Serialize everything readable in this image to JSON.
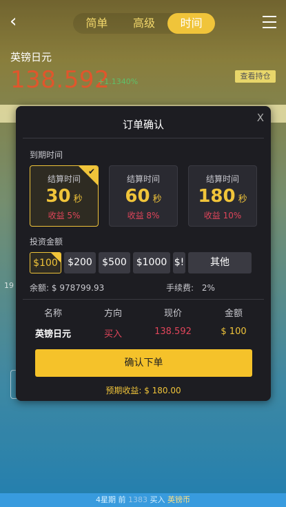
{
  "header": {
    "back_icon": "chevron-left-icon",
    "tabs": [
      {
        "label": "简单",
        "active": false
      },
      {
        "label": "高级",
        "active": false
      },
      {
        "label": "时间",
        "active": true
      }
    ],
    "menu_icon": "hamburger-menu-icon"
  },
  "asset": {
    "name": "英镑日元",
    "price": "138.592",
    "change": "+1.1340%",
    "hold_button": "查看持仓"
  },
  "background": {
    "side_left": "19",
    "ticker": {
      "prefix": "4星期 前",
      "number": "1383",
      "action": "买入",
      "symbol": "英镑币"
    }
  },
  "modal": {
    "title": "订单确认",
    "close_label": "X",
    "expiry_section": "到期时间",
    "time_options": [
      {
        "label": "结算时间",
        "value": "30",
        "unit": "秒",
        "profit": "收益 5%",
        "selected": true
      },
      {
        "label": "结算时间",
        "value": "60",
        "unit": "秒",
        "profit": "收益 8%",
        "selected": false
      },
      {
        "label": "结算时间",
        "value": "180",
        "unit": "秒",
        "profit": "收益 10%",
        "selected": false
      }
    ],
    "amount_section": "投资金额",
    "amounts": [
      {
        "label": "$100",
        "selected": true
      },
      {
        "label": "$200",
        "selected": false
      },
      {
        "label": "$500",
        "selected": false
      },
      {
        "label": "$1000",
        "selected": false
      },
      {
        "label": "$!",
        "selected": false
      },
      {
        "label": "其他",
        "selected": false
      }
    ],
    "balance_label": "余额:",
    "balance_value": "$ 978799.93",
    "fee_label": "手续费:",
    "fee_value": "2%",
    "table_headers": [
      "名称",
      "方向",
      "现价",
      "金额"
    ],
    "table_row": {
      "name": "英镑日元",
      "direction": "买入",
      "price": "138.592",
      "amount": "$ 100"
    },
    "confirm_button": "确认下单",
    "expected_profit": "预期收益: $ 180.00"
  },
  "colors": {
    "accent": "#f0c43a",
    "profit_red": "#e0455a",
    "price_red": "#e0562c",
    "change_green": "#5ec06a",
    "modal_bg": "#1d1d22"
  }
}
